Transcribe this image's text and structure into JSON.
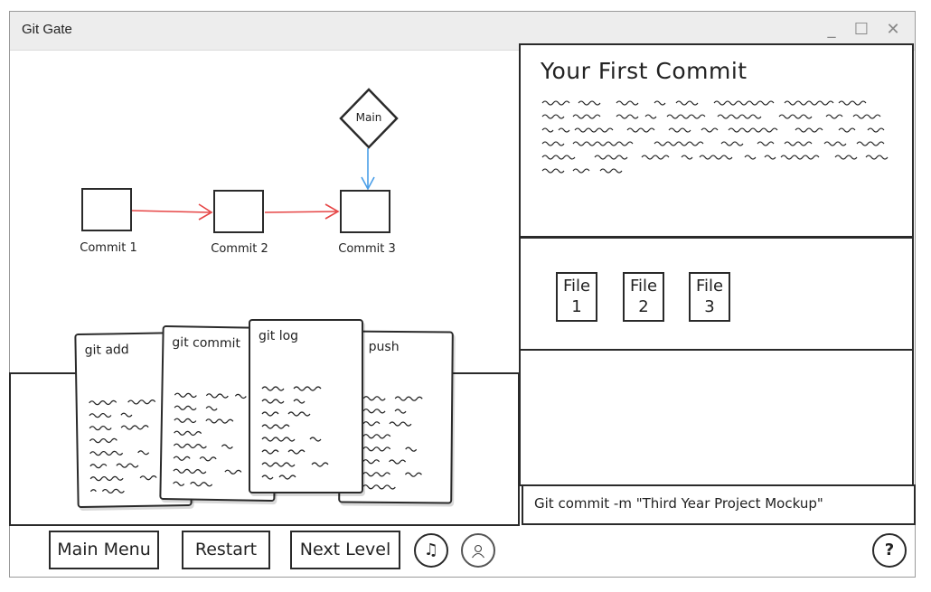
{
  "window": {
    "title": "Git Gate",
    "controls": {
      "minimize": "_",
      "maximize": "☐",
      "close": "✕"
    }
  },
  "graph": {
    "commits": [
      {
        "label": "Commit 1"
      },
      {
        "label": "Commit 2"
      },
      {
        "label": "Commit 3"
      }
    ],
    "branch": {
      "label": "Main"
    },
    "arrow_color": "#e64545",
    "branch_arrow_color": "#4a9ee8"
  },
  "cards": [
    {
      "title": "git add"
    },
    {
      "title": "git commit"
    },
    {
      "title": "git log"
    },
    {
      "title": "push"
    }
  ],
  "level": {
    "title": "Your First Commit"
  },
  "files": [
    {
      "label": "File",
      "number": "1"
    },
    {
      "label": "File",
      "number": "2"
    },
    {
      "label": "File",
      "number": "3"
    }
  ],
  "command": {
    "text": "Git commit -m \"Third Year Project Mockup\""
  },
  "bottom_bar": {
    "main_menu": "Main Menu",
    "restart": "Restart",
    "next_level": "Next Level",
    "music_icon": "♫",
    "profile_icon": "user-icon",
    "help": "?"
  }
}
